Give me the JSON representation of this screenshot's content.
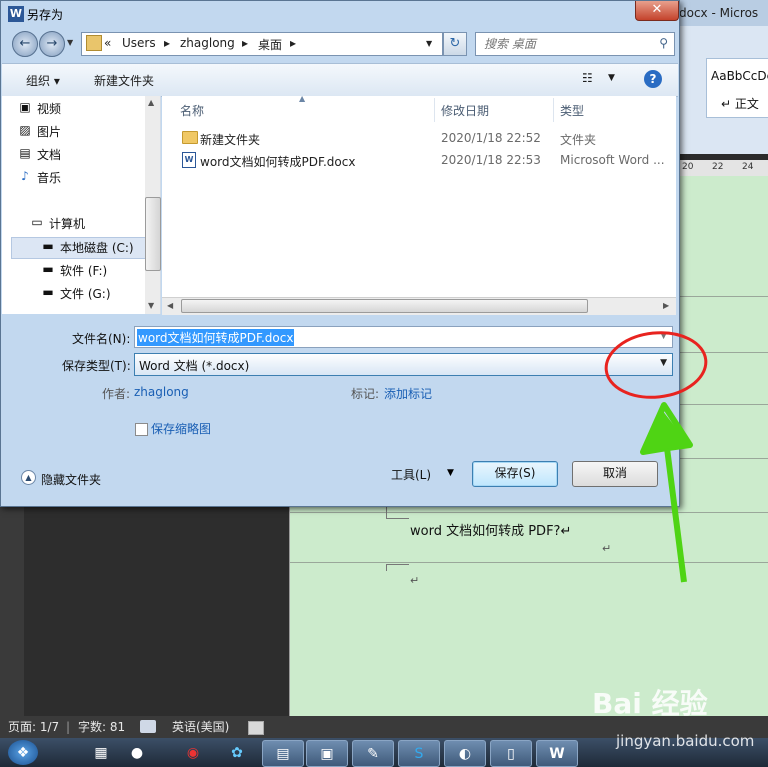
{
  "word_window": {
    "title_fragment": "docx - Micros",
    "style_sample": "AaBbCcDc",
    "style_name": "↵ 正文",
    "ruler_numbers": [
      "20",
      "22",
      "24"
    ],
    "doc_text": "word 文档如何转成 PDF?↵",
    "para_mark": "↵"
  },
  "status_bar": {
    "page": "页面: 1/7",
    "words": "字数: 81",
    "language": "英语(美国)"
  },
  "dialog": {
    "title": "另存为",
    "close_glyph": "✕",
    "breadcrumb": [
      "«",
      "Users",
      "▸",
      "zhaglong",
      "▸",
      "桌面",
      "▸"
    ],
    "search_placeholder": "搜索 桌面",
    "toolbar": {
      "organize": "组织 ▾",
      "new_folder": "新建文件夹"
    },
    "nav": [
      {
        "label": "视频",
        "icon": "video-icon"
      },
      {
        "label": "图片",
        "icon": "pictures-icon"
      },
      {
        "label": "文档",
        "icon": "documents-icon"
      },
      {
        "label": "音乐",
        "icon": "music-icon"
      },
      {
        "label": "计算机",
        "icon": "computer-icon"
      },
      {
        "label": "本地磁盘 (C:)",
        "icon": "drive-icon"
      },
      {
        "label": "软件 (F:)",
        "icon": "drive-icon"
      },
      {
        "label": "文件 (G:)",
        "icon": "drive-icon"
      }
    ],
    "columns": {
      "name": "名称",
      "modified": "修改日期",
      "type": "类型"
    },
    "files": [
      {
        "name": "新建文件夹",
        "modified": "2020/1/18 22:52",
        "type": "文件夹",
        "icon": "folder-icon"
      },
      {
        "name": "word文档如何转成PDF.docx",
        "modified": "2020/1/18 22:53",
        "type": "Microsoft Word ...",
        "icon": "word-doc-icon"
      }
    ],
    "form": {
      "filename_label": "文件名(N):",
      "filename_value": "word文档如何转成PDF.docx",
      "filetype_label": "保存类型(T):",
      "filetype_value": "Word 文档 (*.docx)",
      "author_label": "作者:",
      "author_value": "zhaglong",
      "tags_label": "标记:",
      "tags_value": "添加标记",
      "thumbnail_label": "保存缩略图"
    },
    "footer": {
      "hide_folders": "隐藏文件夹",
      "tools": "工具(L)",
      "save": "保存(S)",
      "cancel": "取消"
    }
  },
  "watermark": {
    "logo_text": "Bai 经验",
    "url": "jingyan.baidu.com"
  },
  "colors": {
    "dialog_bg": "#c2d8ef",
    "doc_bg": "#ccebcc",
    "annotation_red": "#e8231f",
    "annotation_green": "#4fd414",
    "selection_blue": "#3399ff"
  }
}
